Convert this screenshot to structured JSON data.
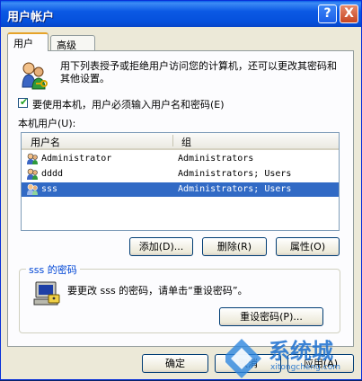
{
  "window": {
    "title": "用户帐户",
    "help_glyph": "?",
    "close_glyph": "X"
  },
  "tabs": [
    {
      "label": "用户"
    },
    {
      "label": "高级"
    }
  ],
  "intro": {
    "text": "用下列表授予或拒绝用户访问您的计算机，还可以更改其密码和其他设置。",
    "icon": "users-keys-icon"
  },
  "checkbox": {
    "label": "要使用本机，用户必须输入用户名和密码(E)",
    "checked": true
  },
  "local_users": {
    "label": "本机用户(U):",
    "columns": [
      "用户名",
      "组"
    ],
    "rows": [
      {
        "name": "Administrator",
        "group": "Administrators",
        "selected": false
      },
      {
        "name": "dddd",
        "group": "Administrators; Users",
        "selected": false
      },
      {
        "name": "sss",
        "group": "Administrators; Users",
        "selected": true
      }
    ]
  },
  "list_buttons": {
    "add": "添加(D)...",
    "delete": "删除(R)",
    "properties": "属性(O)"
  },
  "password_group": {
    "title": "sss 的密码",
    "text": "要更改 sss 的密码，请单击“重设密码”。",
    "reset_button": "重设密码(P)..."
  },
  "dialog_buttons": {
    "ok": "确定",
    "cancel": "取消",
    "apply": "应用(A)"
  },
  "watermark": {
    "brand": "系统城",
    "url": "xitongcheng.com"
  }
}
